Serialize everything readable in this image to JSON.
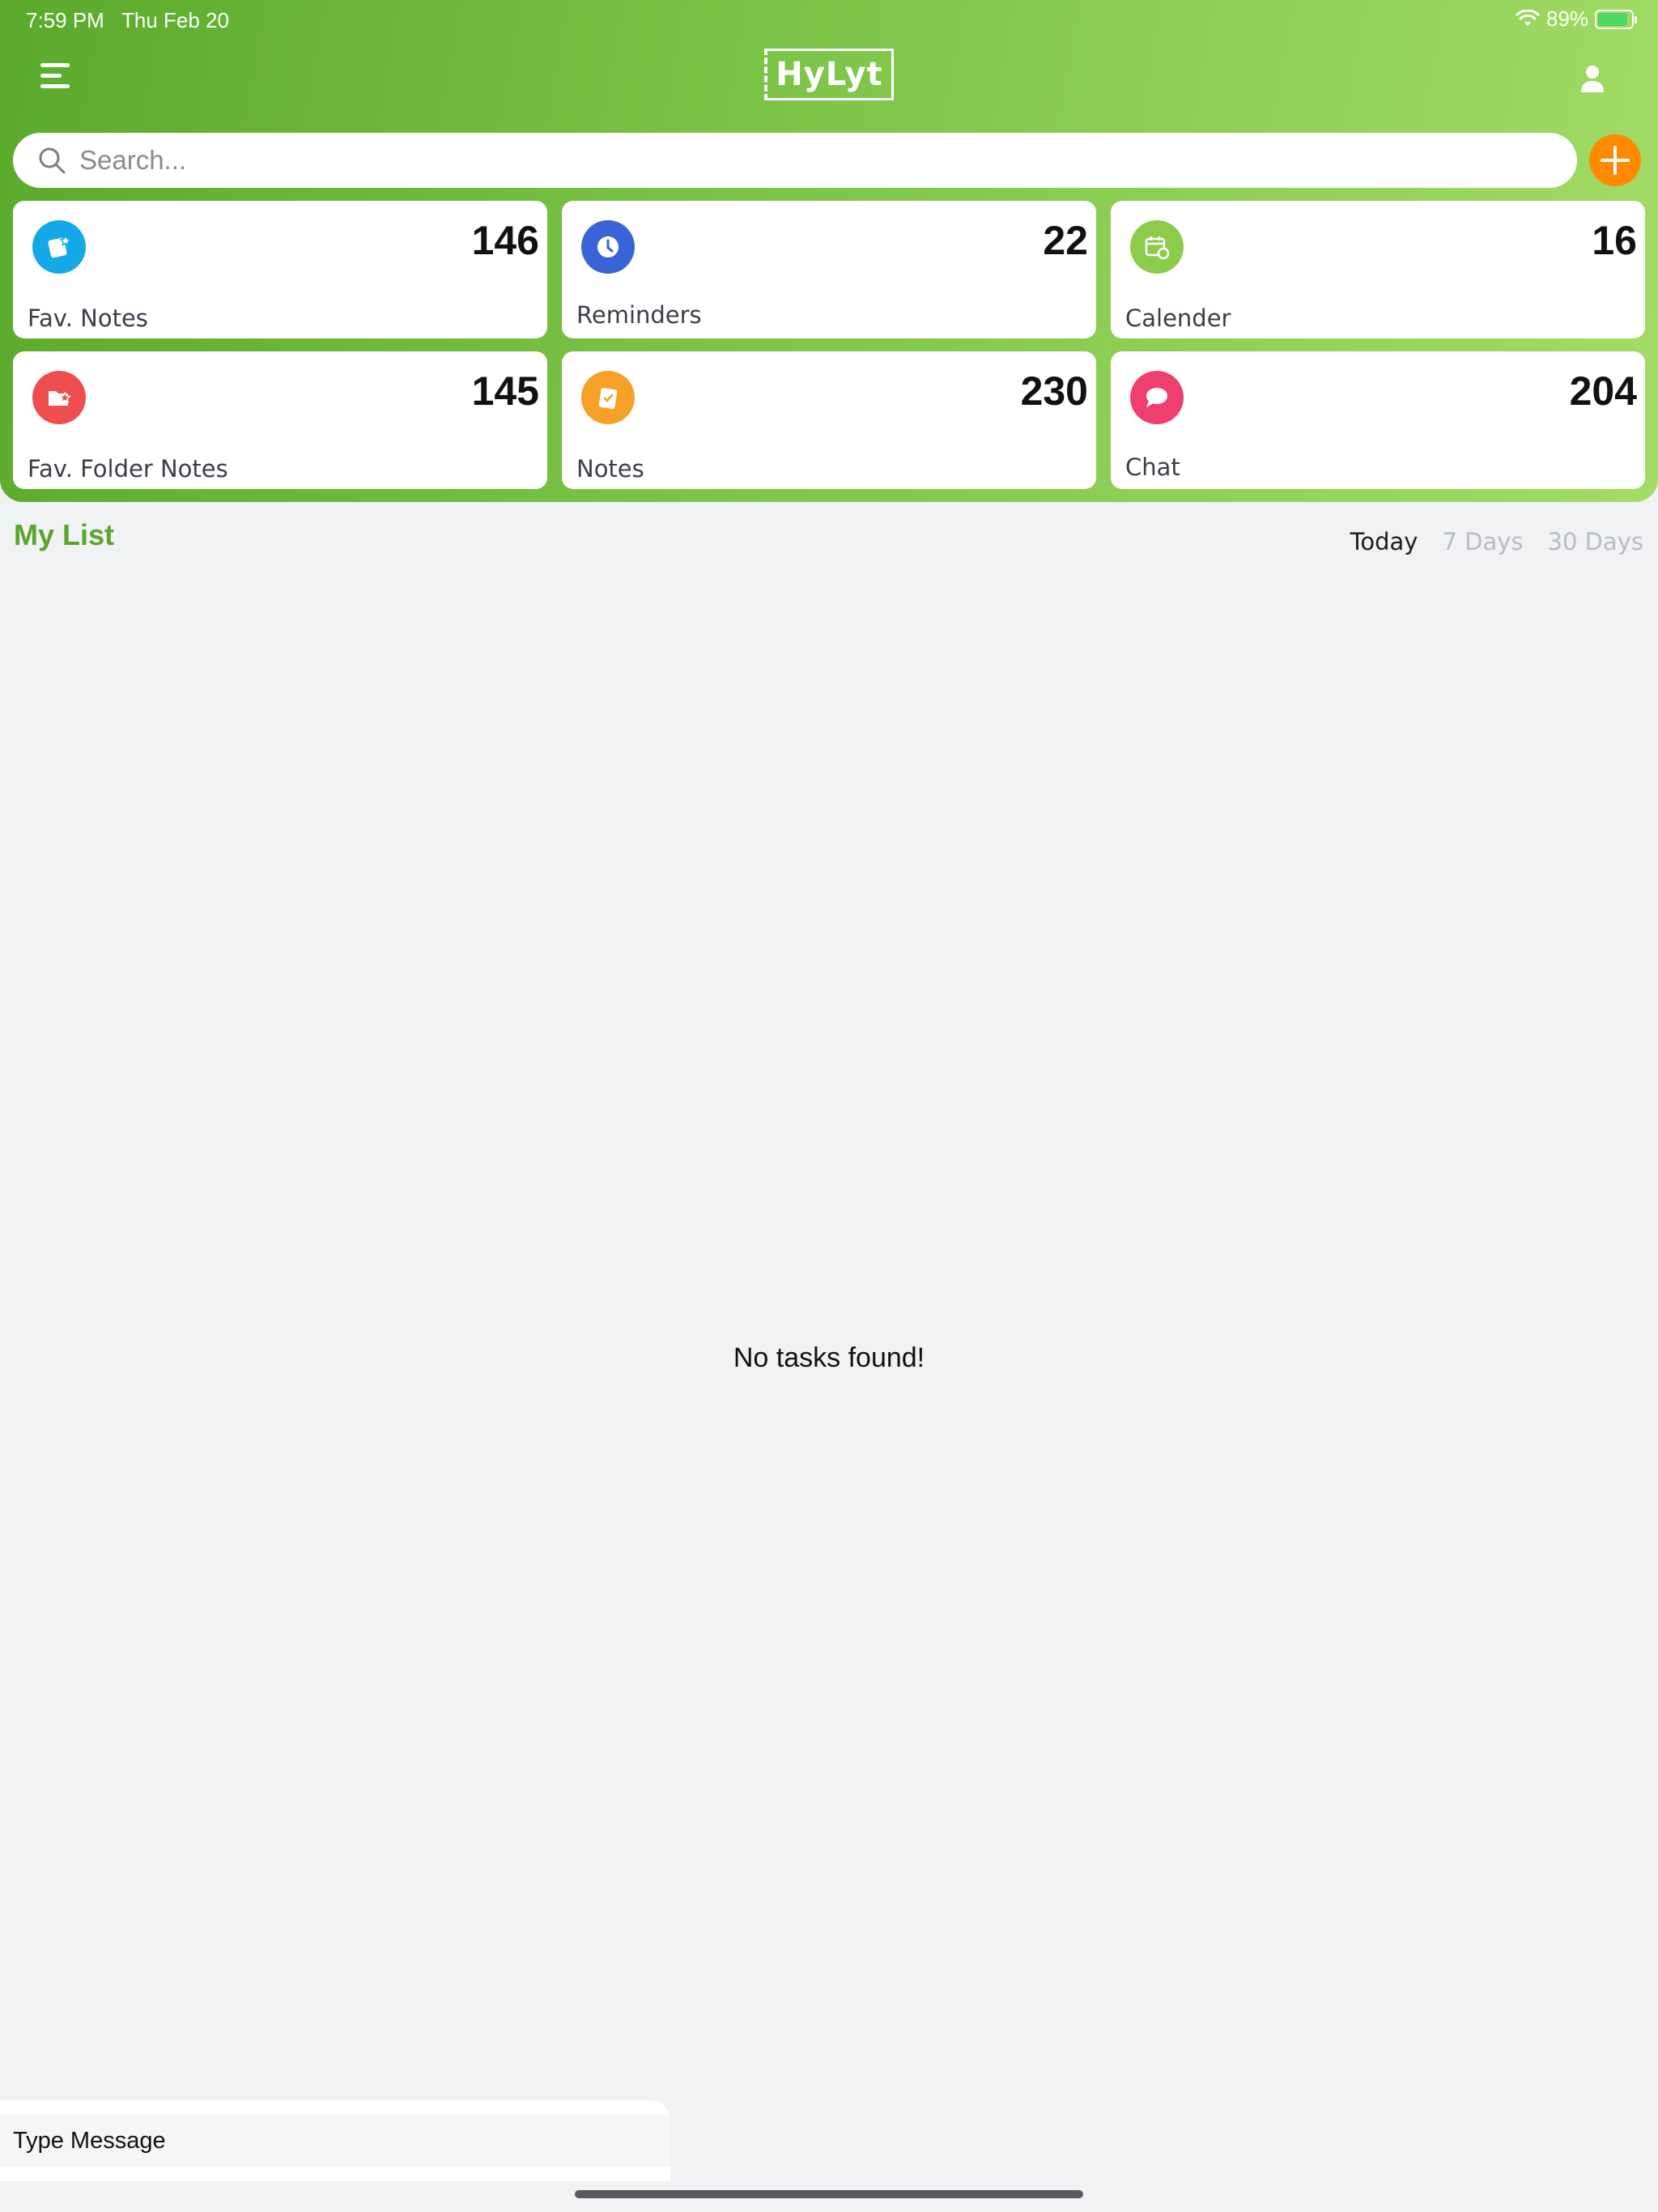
{
  "status_bar": {
    "time": "7:59 PM",
    "date": "Thu Feb 20",
    "battery": "89%",
    "battery_level": 0.89,
    "icons": [
      "wifi-icon",
      "battery-icon",
      "charging-bolt-icon"
    ]
  },
  "header": {
    "logo_text": "HyLyt",
    "menu_icon": "menu-icon",
    "profile_icon": "user-icon",
    "colors": {
      "gradient_start": "#5aaa2c",
      "gradient_end": "#a3dc66"
    }
  },
  "search": {
    "placeholder": "Search...",
    "value": "",
    "icon": "search-icon",
    "add_button_icon": "plus-icon",
    "add_button_color": "#ff8a00"
  },
  "cards": [
    {
      "label": "Fav. Notes",
      "count": "146",
      "icon": "star-note-icon",
      "color": "#15a8e8"
    },
    {
      "label": "Reminders",
      "count": "22",
      "icon": "clock-icon",
      "color": "#3a63d8"
    },
    {
      "label": "Calender",
      "count": "16",
      "icon": "calendar-icon",
      "color": "#8ccc4a"
    },
    {
      "label": "Fav. Folder Notes",
      "count": "145",
      "icon": "star-folder-icon",
      "color": "#ee4e4e"
    },
    {
      "label": "Notes",
      "count": "230",
      "icon": "clipboard-icon",
      "color": "#f5a127"
    },
    {
      "label": "Chat",
      "count": "204",
      "icon": "chat-bubble-icon",
      "color": "#ee3f6e"
    }
  ],
  "my_list": {
    "title": "My List",
    "tabs": [
      {
        "label": "Today",
        "active": true
      },
      {
        "label": "7 Days",
        "active": false
      },
      {
        "label": "30 Days",
        "active": false
      }
    ],
    "empty_message": "No tasks found!"
  },
  "message_bar": {
    "placeholder": "Type Message"
  }
}
